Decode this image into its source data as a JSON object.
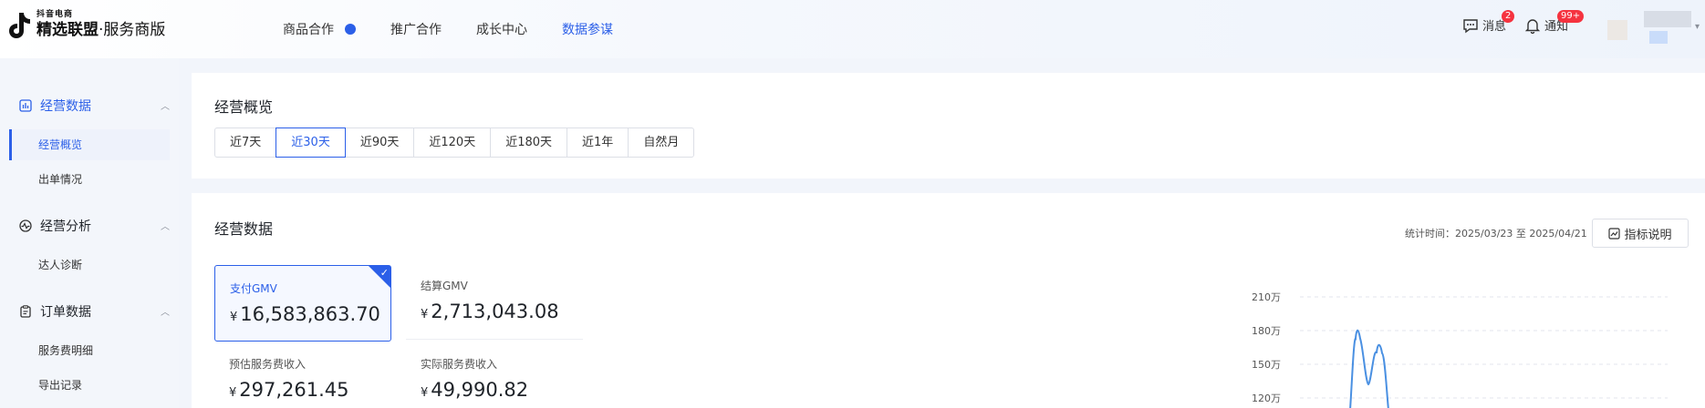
{
  "header": {
    "logo_small": "抖音电商",
    "logo_bold": "精选联盟",
    "logo_rest": "·服务商版",
    "nav": [
      {
        "label": "商品合作",
        "active": false,
        "dot": true
      },
      {
        "label": "推广合作",
        "active": false
      },
      {
        "label": "成长中心",
        "active": false
      },
      {
        "label": "数据参谋",
        "active": true
      }
    ],
    "messages": {
      "label": "消息",
      "badge": "2"
    },
    "notifications": {
      "label": "通知",
      "badge": "99+"
    }
  },
  "sidebar": {
    "groups": [
      {
        "label": "经营数据",
        "icon": "bar-chart-icon",
        "active": true,
        "items": [
          {
            "label": "经营概览",
            "active": true
          },
          {
            "label": "出单情况",
            "active": false
          }
        ]
      },
      {
        "label": "经营分析",
        "icon": "pulse-icon",
        "active": false,
        "items": [
          {
            "label": "达人诊断",
            "active": false
          }
        ]
      },
      {
        "label": "订单数据",
        "icon": "clipboard-icon",
        "active": false,
        "items": [
          {
            "label": "服务费明细",
            "active": false
          },
          {
            "label": "导出记录",
            "active": false
          }
        ]
      }
    ]
  },
  "overview": {
    "title": "经营概览",
    "ranges": [
      "近7天",
      "近30天",
      "近90天",
      "近120天",
      "近180天",
      "近1年",
      "自然月"
    ],
    "selected_range": "近30天"
  },
  "business": {
    "title": "经营数据",
    "stat_time": "统计时间：2025/03/23 至 2025/04/21",
    "metric_button": "指标说明",
    "metrics": [
      {
        "label": "支付GMV",
        "currency": "¥",
        "value": "16,583,863.70",
        "selected": true
      },
      {
        "label": "结算GMV",
        "currency": "¥",
        "value": "2,713,043.08",
        "selected": false
      },
      {
        "label": "预估服务费收入",
        "currency": "¥",
        "value": "297,261.45",
        "selected": false
      },
      {
        "label": "实际服务费收入",
        "currency": "¥",
        "value": "49,990.82",
        "selected": false
      }
    ]
  },
  "chart_data": {
    "type": "line",
    "y_ticks": [
      "210万",
      "180万",
      "150万",
      "120万"
    ],
    "ylim_wan": [
      120,
      210
    ],
    "peaks_wan": [
      181,
      168
    ],
    "series_color": "#4a90e2",
    "grid": "dashed-horizontal"
  }
}
